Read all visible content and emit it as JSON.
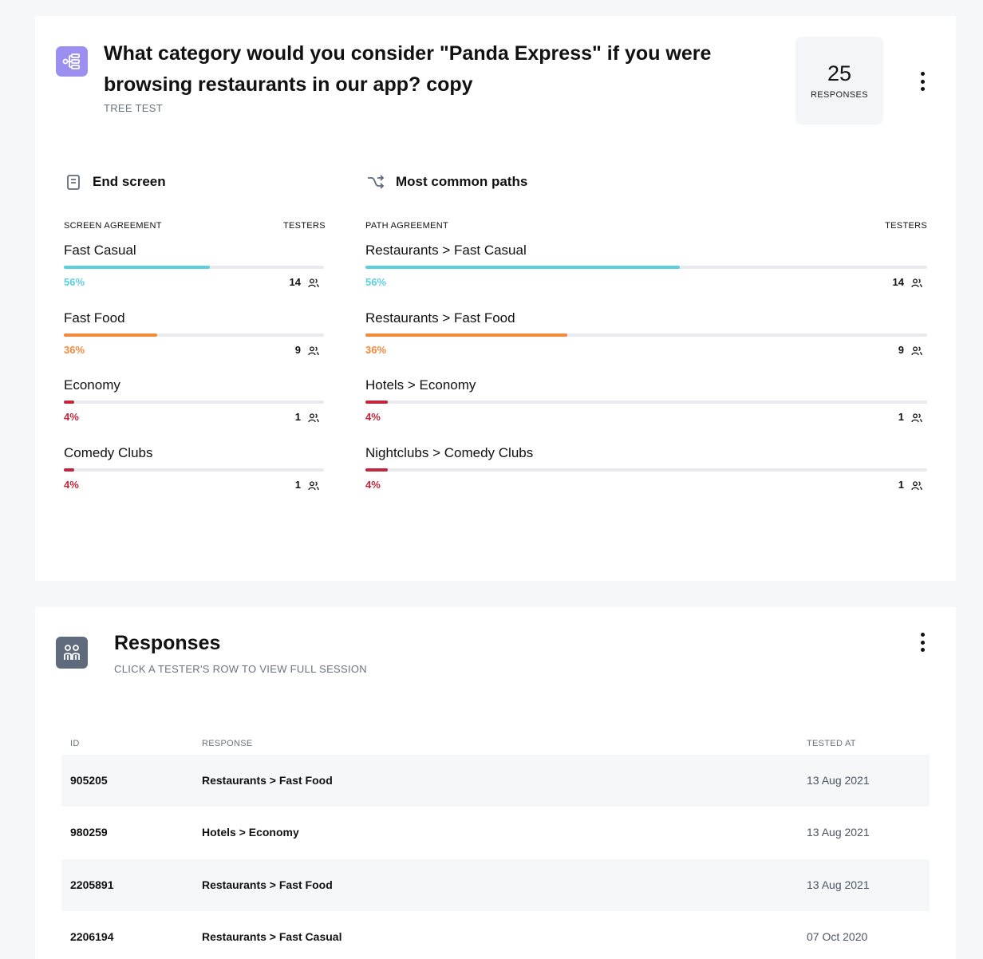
{
  "question": {
    "title": "What category would you consider \"Panda Express\" if you were browsing restaurants in our app? copy",
    "type": "TREE TEST",
    "responses_count": "25",
    "responses_label": "RESPONSES"
  },
  "end_screen": {
    "heading": "End screen",
    "col_left": "SCREEN AGREEMENT",
    "col_right": "TESTERS",
    "items": [
      {
        "name": "Fast Casual",
        "pct": "56%",
        "value": 0.56,
        "count": "14",
        "color": "#5bcfe0"
      },
      {
        "name": "Fast Food",
        "pct": "36%",
        "value": 0.36,
        "count": "9",
        "color": "#f28a3c"
      },
      {
        "name": "Economy",
        "pct": "4%",
        "value": 0.04,
        "count": "1",
        "color": "#c0273d"
      },
      {
        "name": "Comedy Clubs",
        "pct": "4%",
        "value": 0.04,
        "count": "1",
        "color": "#c0273d"
      }
    ]
  },
  "paths": {
    "heading": "Most common paths",
    "col_left": "PATH AGREEMENT",
    "col_right": "TESTERS",
    "items": [
      {
        "name": "Restaurants > Fast Casual",
        "pct": "56%",
        "value": 0.56,
        "count": "14",
        "color": "#5bcfe0"
      },
      {
        "name": "Restaurants > Fast Food",
        "pct": "36%",
        "value": 0.36,
        "count": "9",
        "color": "#f28a3c"
      },
      {
        "name": "Hotels > Economy",
        "pct": "4%",
        "value": 0.04,
        "count": "1",
        "color": "#c0273d"
      },
      {
        "name": "Nightclubs > Comedy Clubs",
        "pct": "4%",
        "value": 0.04,
        "count": "1",
        "color": "#c0273d"
      }
    ]
  },
  "responses": {
    "title": "Responses",
    "subtitle": "CLICK A TESTER'S ROW TO VIEW FULL SESSION",
    "columns": {
      "id": "ID",
      "response": "RESPONSE",
      "tested_at": "TESTED AT"
    },
    "rows": [
      {
        "id": "905205",
        "response": "Restaurants > Fast Food",
        "tested_at": "13 Aug 2021"
      },
      {
        "id": "980259",
        "response": "Hotels > Economy",
        "tested_at": "13 Aug 2021"
      },
      {
        "id": "2205891",
        "response": "Restaurants > Fast Food",
        "tested_at": "13 Aug 2021"
      },
      {
        "id": "2206194",
        "response": "Restaurants > Fast Casual",
        "tested_at": "07 Oct 2020"
      }
    ]
  },
  "icons": {
    "question_type": "tree-test-icon",
    "end_screen": "document-icon",
    "paths": "shuffle-icon",
    "testers": "people-icon",
    "responses": "people-icon",
    "menu": "kebab-menu-icon"
  },
  "colors": {
    "tree_test_accent": "#9b8ff0",
    "responses_accent": "#5f6b7d",
    "high": "#5bcfe0",
    "medium": "#f28a3c",
    "low": "#c0273d"
  }
}
